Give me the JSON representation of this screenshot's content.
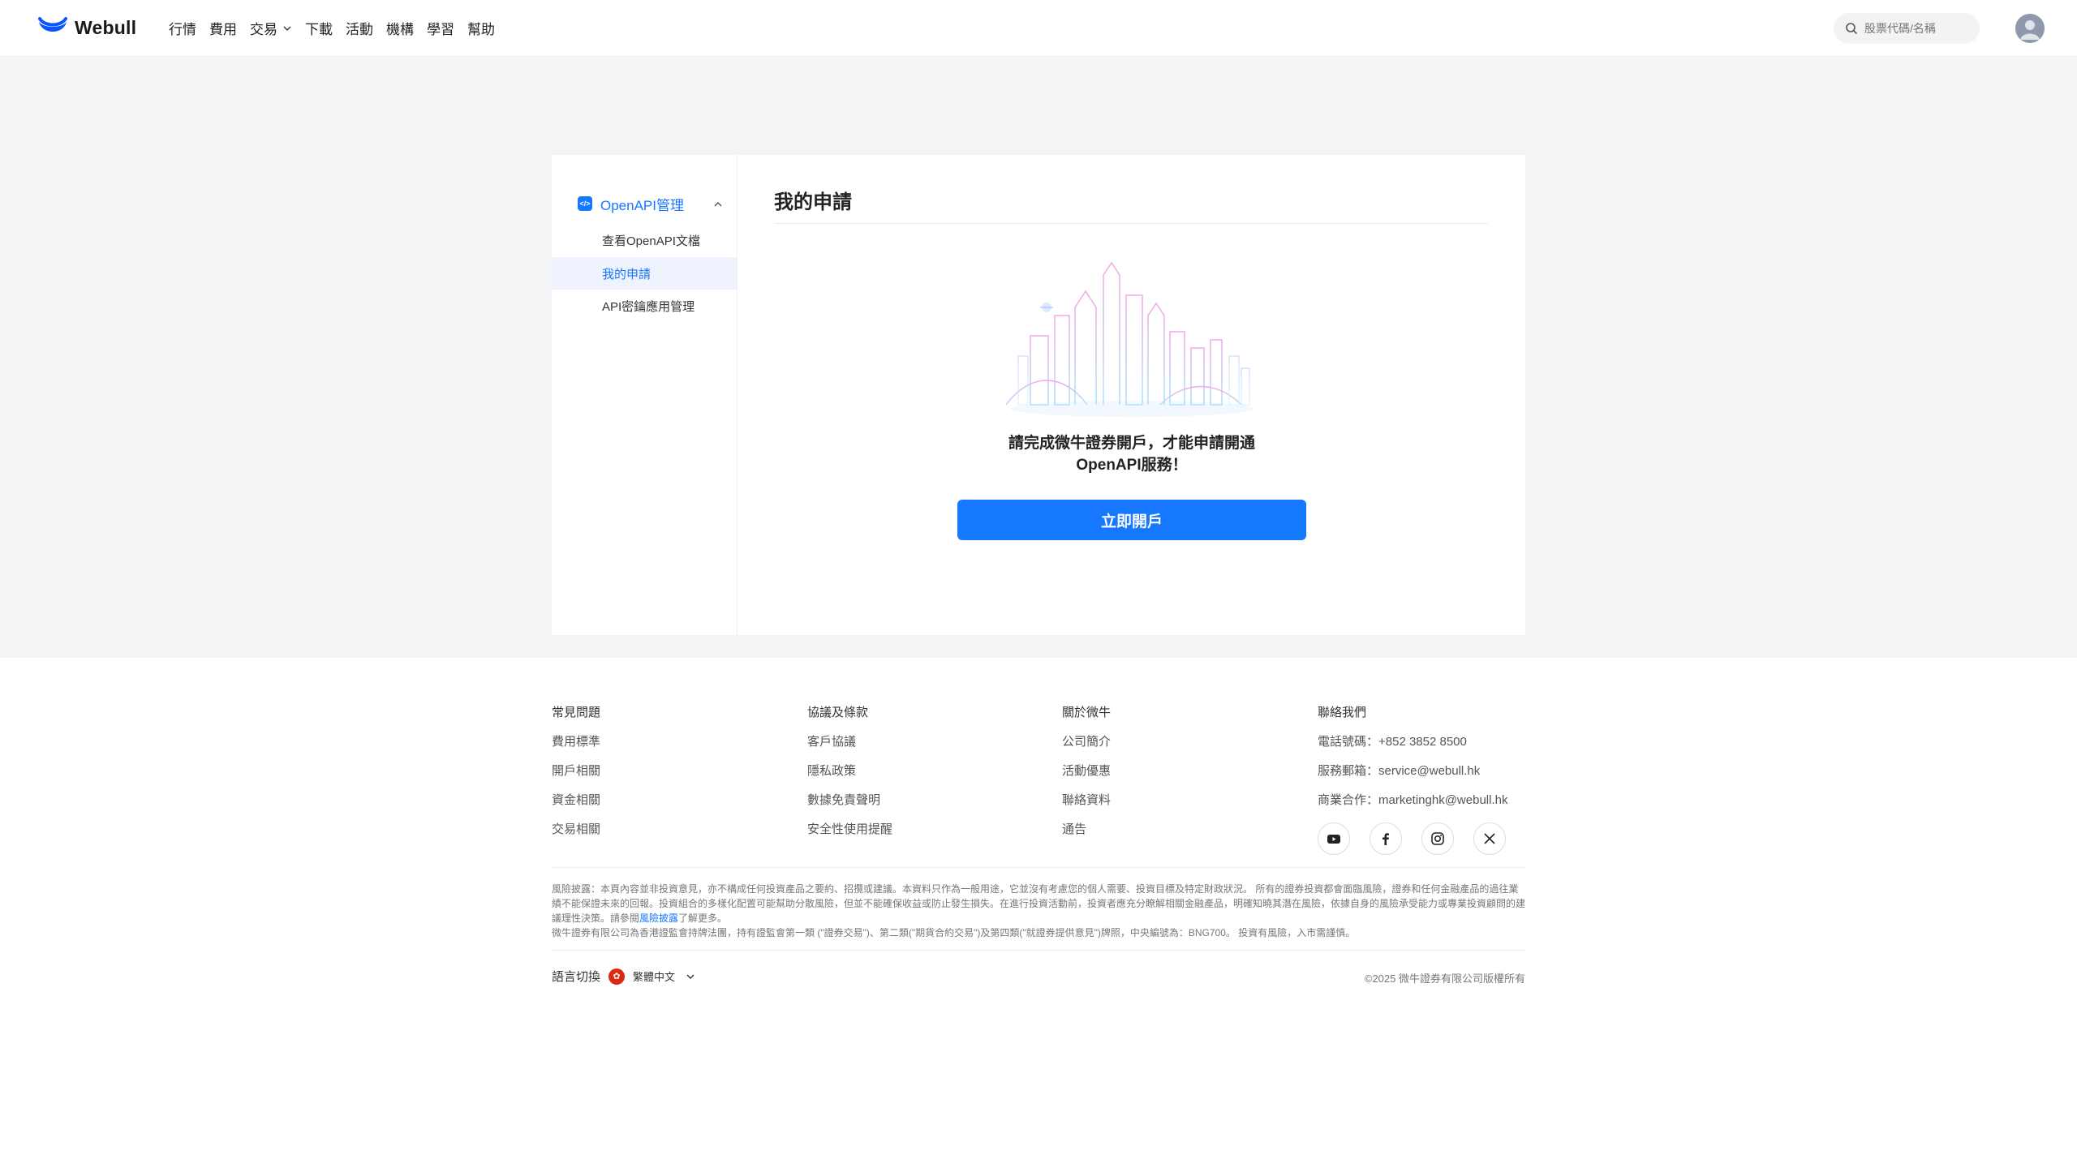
{
  "header": {
    "brand": "Webull",
    "nav": [
      {
        "label": "行情"
      },
      {
        "label": "費用"
      },
      {
        "label": "交易"
      },
      {
        "label": "下載"
      },
      {
        "label": "活動"
      },
      {
        "label": "機構"
      },
      {
        "label": "學習"
      },
      {
        "label": "幫助"
      }
    ],
    "search_placeholder": "股票代碼/名稱"
  },
  "sidebar": {
    "group_label": "OpenAPI管理",
    "group_icon_text": "</>",
    "items": [
      {
        "label": "查看OpenAPI文檔",
        "active": false
      },
      {
        "label": "我的申請",
        "active": true
      },
      {
        "label": "API密鑰應用管理",
        "active": false
      }
    ]
  },
  "content": {
    "title": "我的申請",
    "message_line1": "請完成微牛證券開戶，才能申請開通",
    "message_line2": "OpenAPI服務！",
    "button_label": "立即開戶"
  },
  "footer": {
    "columns": [
      {
        "heading": "常見問題",
        "links": [
          "費用標準",
          "開戶相關",
          "資金相關",
          "交易相關"
        ]
      },
      {
        "heading": "協議及條款",
        "links": [
          "客戶協議",
          "隱私政策",
          "數據免責聲明",
          "安全性使用提醒"
        ]
      },
      {
        "heading": "關於微牛",
        "links": [
          "公司簡介",
          "活動優惠",
          "聯絡資料",
          "通告"
        ]
      },
      {
        "heading": "聯絡我們",
        "links": [
          "電話號碼：+852 3852 8500",
          "服務郵箱：service@webull.hk",
          "商業合作：marketinghk@webull.hk"
        ]
      }
    ],
    "social": [
      "youtube-icon",
      "facebook-icon",
      "instagram-icon",
      "x-icon"
    ],
    "disclaimer_part1": "風險披露：本頁內容並非投資意見，亦不構成任何投資產品之要約、招攬或建議。本資料只作為一般用途，它並沒有考慮您的個人需要、投資目標及特定財政狀況。 所有的證券投資都會面臨風險，證券和任何金融產品的過往業績不能保證未來的回報。投資組合的多樣化配置可能幫助分散風險，但並不能確保收益或防止發生損失。在進行投資活動前，投資者應充分瞭解相關金融產品，明確知曉其潛在風險，依據自身的風險承受能力或專業投資顧問的建議理性決策。請參閱",
    "disclaimer_link": "風險披露",
    "disclaimer_part2": "了解更多。",
    "disclaimer_line2": "微牛證券有限公司為香港證監會持牌法團，持有證監會第一類 (\"證券交易\")、第二類(\"期貨合約交易\")及第四類(\"就證券提供意見\")牌照，中央編號為：BNG700。 投資有風險，入市需謹慎。",
    "lang_label": "語言切換",
    "lang_value": "繁體中文",
    "copyright": "©2025 微牛證券有限公司版權所有"
  }
}
